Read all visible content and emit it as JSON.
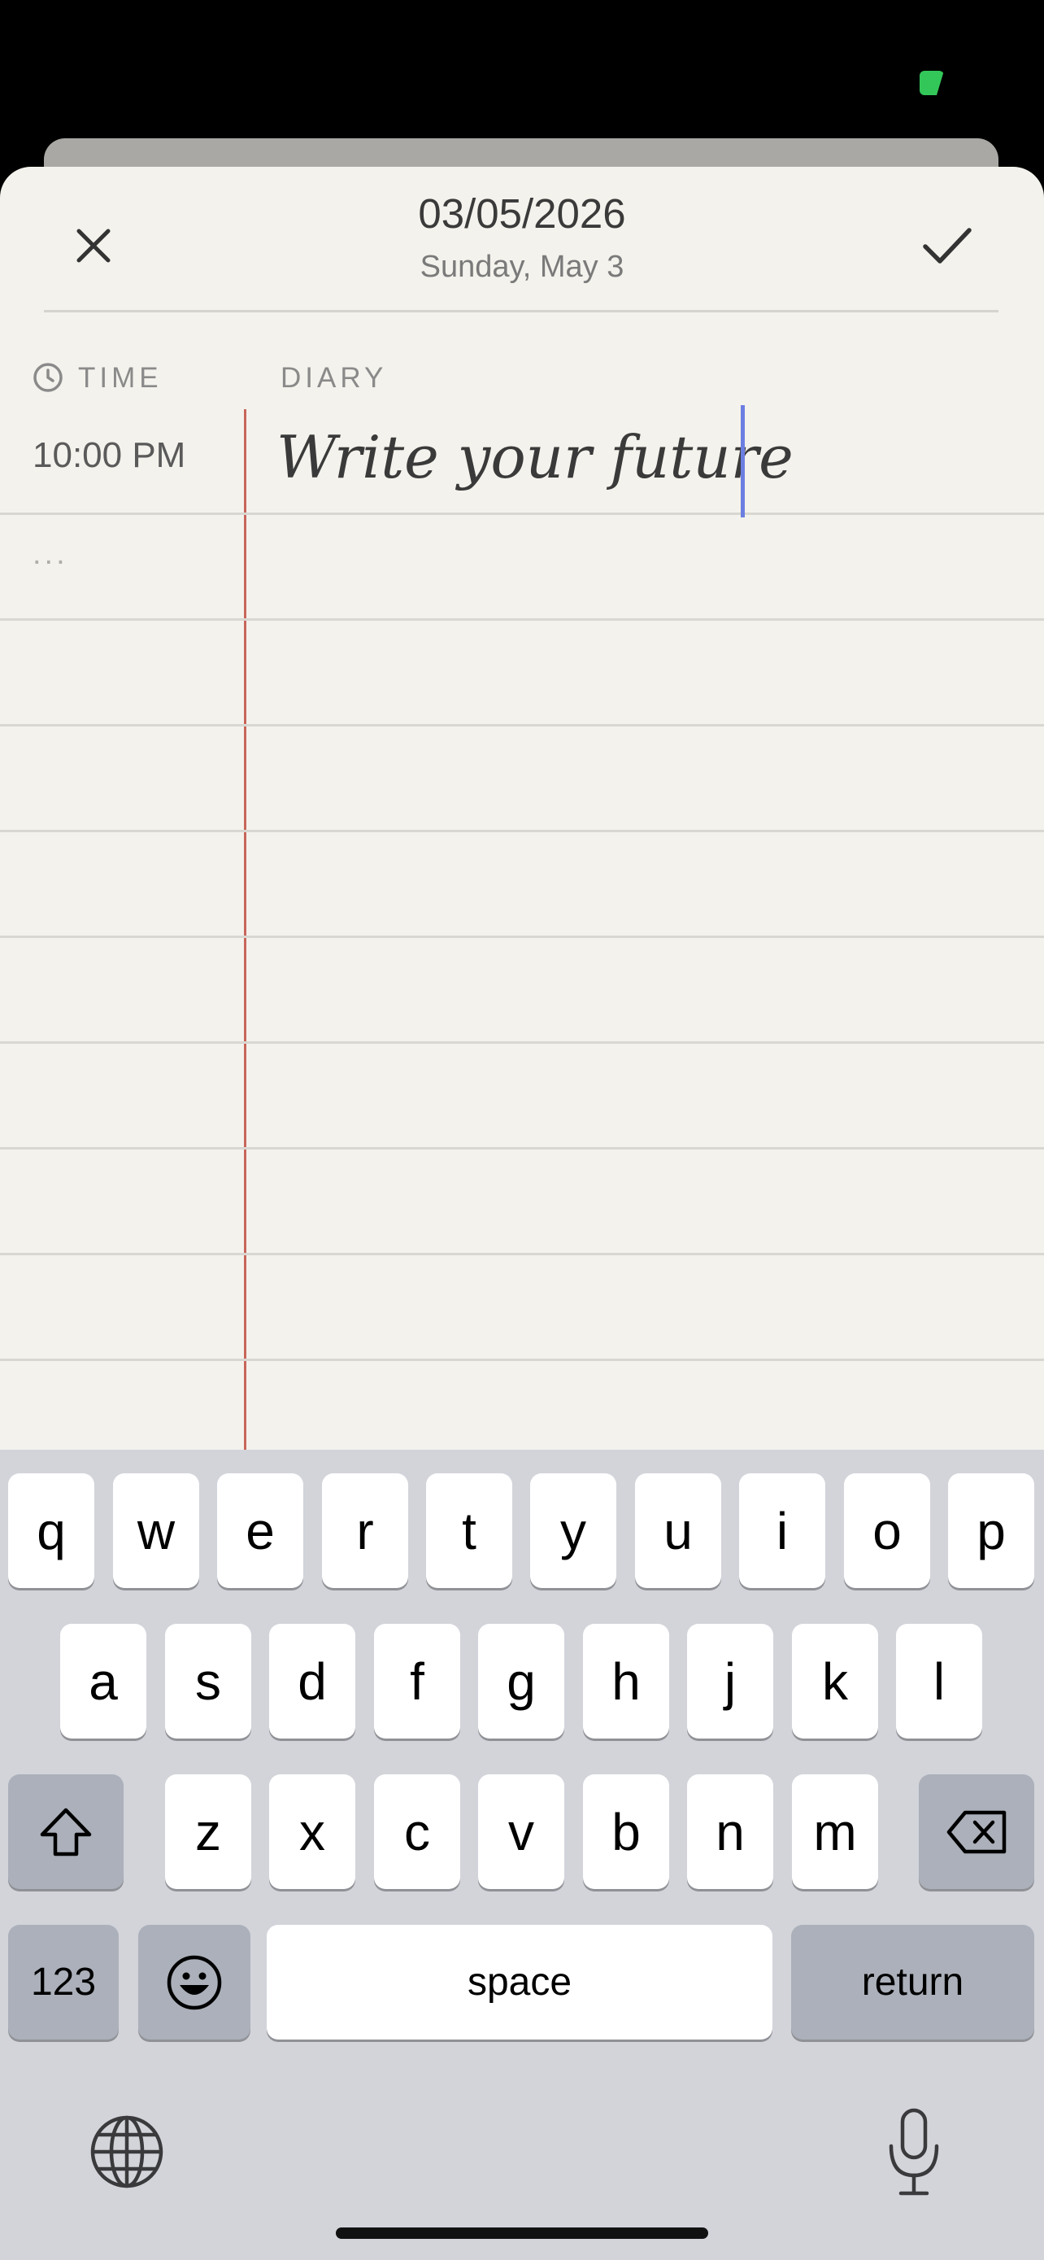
{
  "header": {
    "date": "03/05/2026",
    "weekday": "Sunday, May 3"
  },
  "columns": {
    "time": "TIME",
    "diary": "DIARY"
  },
  "entry": {
    "time": "10:00 PM",
    "placeholder_dots": "...",
    "text": "Write your future"
  },
  "keyboard": {
    "row1": [
      "q",
      "w",
      "e",
      "r",
      "t",
      "y",
      "u",
      "i",
      "o",
      "p"
    ],
    "row2": [
      "a",
      "s",
      "d",
      "f",
      "g",
      "h",
      "j",
      "k",
      "l"
    ],
    "row3": [
      "z",
      "x",
      "c",
      "v",
      "b",
      "n",
      "m"
    ],
    "numbers_label": "123",
    "space_label": "space",
    "return_label": "return"
  },
  "colors": {
    "paper": "#f4f2ec",
    "margin_line": "#c8665a",
    "cursor": "#6c7ee0",
    "status_indicator": "#33c759"
  }
}
